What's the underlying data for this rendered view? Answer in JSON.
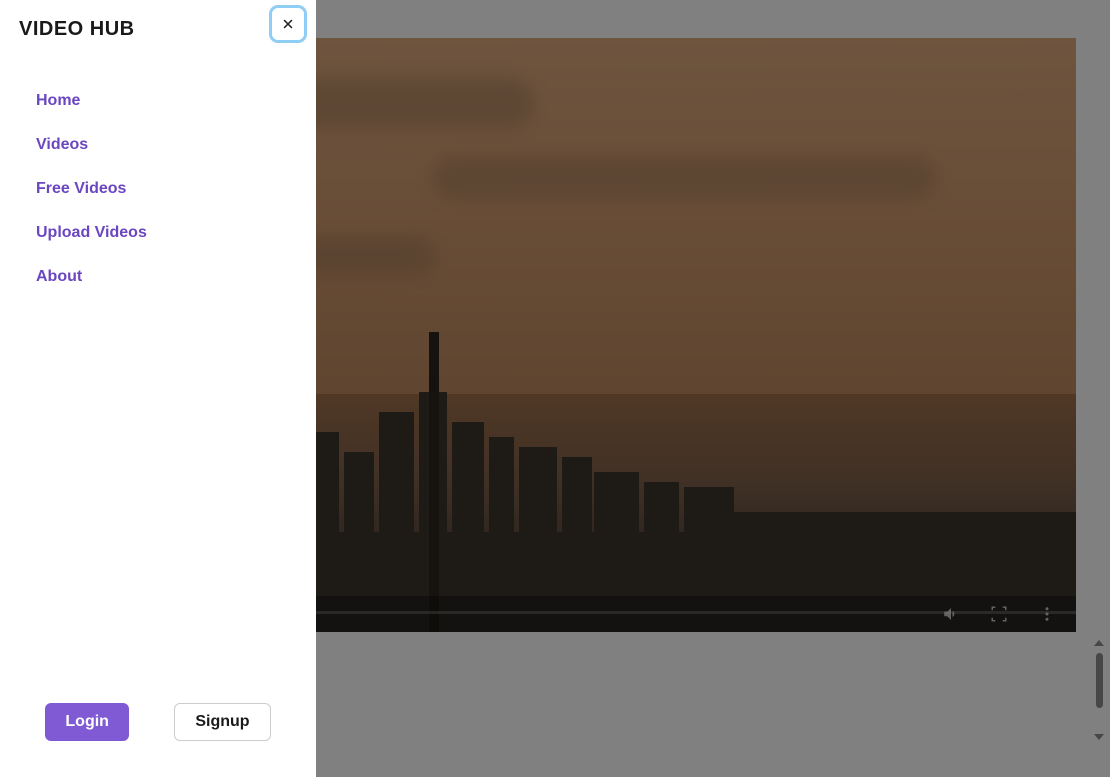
{
  "drawer": {
    "title": "VIDEO HUB",
    "nav": [
      {
        "label": "Home"
      },
      {
        "label": "Videos"
      },
      {
        "label": "Free Videos"
      },
      {
        "label": "Upload Videos"
      },
      {
        "label": "About"
      }
    ],
    "login_label": "Login",
    "signup_label": "Signup"
  }
}
